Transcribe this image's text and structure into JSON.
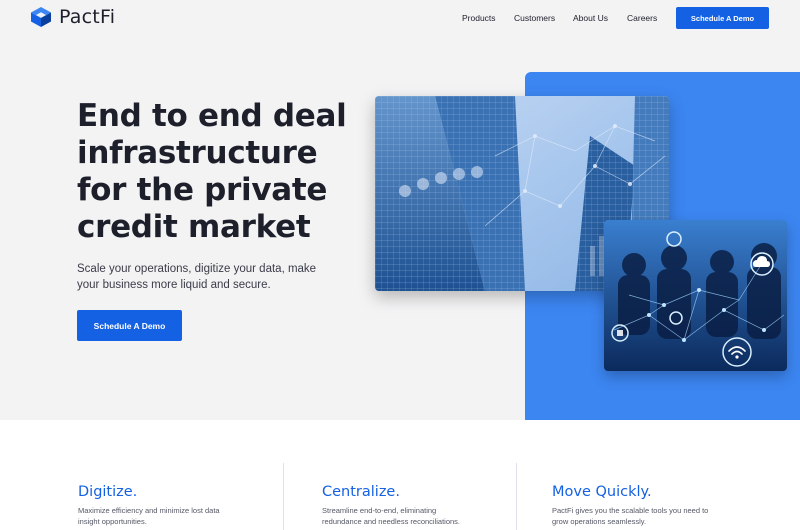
{
  "brand": {
    "name": "PactFi",
    "accent": "#1561e3",
    "panel_blue": "#3c86f2"
  },
  "nav": {
    "items": [
      "Products",
      "Customers",
      "About Us",
      "Careers"
    ],
    "cta_label": "Schedule A Demo"
  },
  "hero": {
    "title_lines": [
      "End to end deal",
      "infrastructure",
      "for the private",
      "credit market"
    ],
    "subtitle_lines": [
      "Scale your operations, digitize your data, make",
      "your business more liquid and secure."
    ],
    "cta_label": "Schedule A Demo",
    "images": [
      "city-skyscraper-photo",
      "network-people-photo"
    ]
  },
  "features": [
    {
      "title": "Digitize.",
      "desc_lines": [
        "Maximize efficiency and minimize lost data",
        "insight opportunities."
      ]
    },
    {
      "title": "Centralize.",
      "desc_lines": [
        "Streamline end-to-end, eliminating",
        "redundance and needless reconciliations."
      ]
    },
    {
      "title": "Move Quickly.",
      "desc_lines": [
        "PactFi gives you the scalable tools you need to",
        "grow operations seamlessly."
      ]
    }
  ]
}
